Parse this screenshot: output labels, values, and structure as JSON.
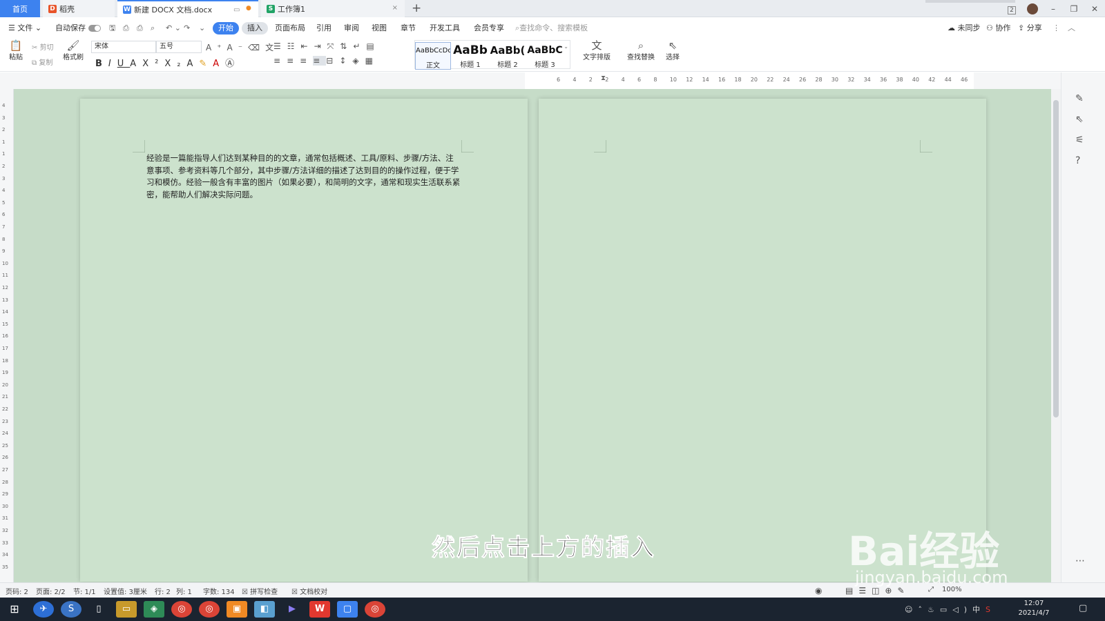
{
  "tabs": [
    {
      "label": "首页"
    },
    {
      "label": "稻壳"
    },
    {
      "label": "新建 DOCX 文档.docx"
    },
    {
      "label": "工作簿1"
    }
  ],
  "titlebar": {
    "badge": "2"
  },
  "menu": {
    "file": "文件",
    "autosave": "自动保存",
    "items": [
      "开始",
      "插入",
      "页面布局",
      "引用",
      "审阅",
      "视图",
      "章节",
      "开发工具",
      "会员专享"
    ],
    "search_placeholder": "查找命令、搜索模板",
    "unsynced": "未同步",
    "collab": "协作",
    "share": "分享"
  },
  "ribbon": {
    "paste": "粘贴",
    "cut": "剪切",
    "copy": "复制",
    "format_painter": "格式刷",
    "font_name": "宋体",
    "font_size": "五号",
    "styles": [
      {
        "preview": "AaBbCcDd",
        "label": "正文"
      },
      {
        "preview": "AaBb",
        "label": "标题 1"
      },
      {
        "preview": "AaBb(",
        "label": "标题 2"
      },
      {
        "preview": "AaBbC",
        "label": "标题 3"
      }
    ],
    "text_layout": "文字排版",
    "find_replace": "查找替换",
    "select": "选择"
  },
  "ruler": {
    "h_ticks": [
      "6",
      "4",
      "2",
      "2",
      "4",
      "6",
      "8",
      "10",
      "12",
      "14",
      "16",
      "18",
      "20",
      "22",
      "24",
      "26",
      "28",
      "30",
      "32",
      "34",
      "36",
      "38",
      "40",
      "42",
      "44",
      "46"
    ],
    "v_ticks": [
      "4",
      "3",
      "2",
      "1",
      "1",
      "2",
      "3",
      "4",
      "5",
      "6",
      "7",
      "8",
      "9",
      "10",
      "11",
      "12",
      "13",
      "14",
      "15",
      "16",
      "17",
      "18",
      "19",
      "20",
      "21",
      "22",
      "23",
      "24",
      "25",
      "26",
      "27",
      "28",
      "29",
      "30",
      "31",
      "32",
      "33",
      "34",
      "35"
    ]
  },
  "document": {
    "body": "经验是一篇能指导人们达到某种目的的文章，通常包括概述、工具/原料、步骤/方法、注意事项、参考资料等几个部分，其中步骤/方法详细的描述了达到目的的操作过程，便于学习和模仿。经验一般含有丰富的图片（如果必要），和简明的文字，通常和现实生活联系紧密，能帮助人们解决实际问题。"
  },
  "status": {
    "page_num": "页码: 2",
    "pages": "页面: 2/2",
    "section": "节: 1/1",
    "setting": "设置值: 3厘米",
    "row": "行: 2",
    "col": "列: 1",
    "words": "字数: 134",
    "spell_check": "拼写检查",
    "doc_proof": "文档校对",
    "zoom": "100%"
  },
  "taskbar": {
    "time": "12:07",
    "date": "2021/4/7",
    "ime": "中"
  },
  "overlay": {
    "subtitle": "然后点击上方的插入",
    "watermark": "Bai经验",
    "watermark_url": "jingyan.baidu.com"
  },
  "colors": {
    "accent": "#3d82ef",
    "page_bg": "#cce2cd",
    "workspace_bg": "#c6dcc8",
    "wps_red": "#e2382f"
  }
}
